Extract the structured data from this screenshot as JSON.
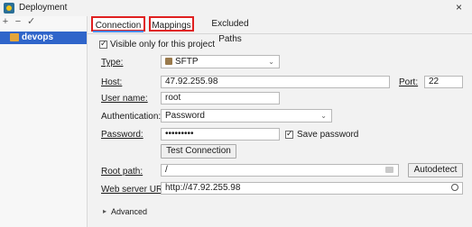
{
  "window": {
    "title": "Deployment",
    "close_glyph": "×"
  },
  "toolbar": {
    "add": "+",
    "remove": "−",
    "apply": "✓"
  },
  "tree": {
    "selected": "devops"
  },
  "tabs": [
    {
      "label": "Connection",
      "selected": true
    },
    {
      "label": "Mappings",
      "selected": false
    },
    {
      "label": "Excluded Paths",
      "selected": false
    }
  ],
  "form": {
    "visible_only": "Visible only for this project",
    "type_label": "Type:",
    "type_value": "SFTP",
    "host_label": "Host:",
    "host_value": "47.92.255.98",
    "port_label": "Port:",
    "port_value": "22",
    "username_label": "User name:",
    "username_value": "root",
    "auth_label": "Authentication:",
    "auth_value": "Password",
    "password_label": "Password:",
    "password_value": "•••••••••",
    "save_password": "Save password",
    "test_connection": "Test Connection",
    "root_path_label": "Root path:",
    "root_path_value": "/",
    "autodetect": "Autodetect",
    "web_url_label": "Web server URL:",
    "web_url_value": "http://47.92.255.98",
    "advanced": "Advanced"
  },
  "colors": {
    "selection": "#2f65ca",
    "highlight_border": "#e02020",
    "tab_underline": "#4a88e6"
  },
  "icons": [
    "deployment-app-icon",
    "close-icon",
    "add-icon",
    "remove-icon",
    "apply-icon",
    "server-folder-icon",
    "sftp-icon",
    "chevron-down-icon",
    "folder-browse-icon",
    "globe-icon",
    "chevron-right-icon"
  ]
}
